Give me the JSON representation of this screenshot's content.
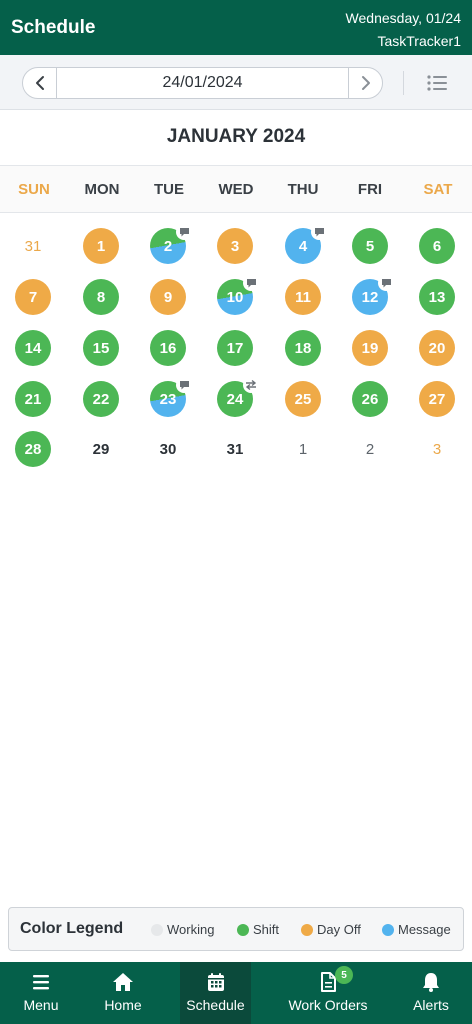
{
  "header": {
    "title": "Schedule",
    "date": "Wednesday, 01/24",
    "org": "TaskTracker1"
  },
  "navbar": {
    "current_date": "24/01/2024"
  },
  "month_title": "JANUARY 2024",
  "weekdays": [
    "SUN",
    "MON",
    "TUE",
    "WED",
    "THU",
    "FRI",
    "SAT"
  ],
  "colors": {
    "working": "#e6e8ea",
    "shift": "#4cb755",
    "dayoff": "#efaa47",
    "message": "#52b3ee",
    "header_bg": "#05604a",
    "weekend_text": "#eba84a"
  },
  "calendar": {
    "weeks": [
      [
        {
          "day": "31",
          "status": "plain",
          "style": "weekend-num"
        },
        {
          "day": "1",
          "status": "dayoff"
        },
        {
          "day": "2",
          "status": "split",
          "badge": "message-icon"
        },
        {
          "day": "3",
          "status": "dayoff"
        },
        {
          "day": "4",
          "status": "message",
          "badge": "message-icon"
        },
        {
          "day": "5",
          "status": "shift"
        },
        {
          "day": "6",
          "status": "shift"
        }
      ],
      [
        {
          "day": "7",
          "status": "dayoff"
        },
        {
          "day": "8",
          "status": "shift"
        },
        {
          "day": "9",
          "status": "dayoff"
        },
        {
          "day": "10",
          "status": "split",
          "badge": "message-icon"
        },
        {
          "day": "11",
          "status": "dayoff"
        },
        {
          "day": "12",
          "status": "message",
          "badge": "message-icon"
        },
        {
          "day": "13",
          "status": "shift"
        }
      ],
      [
        {
          "day": "14",
          "status": "shift"
        },
        {
          "day": "15",
          "status": "shift"
        },
        {
          "day": "16",
          "status": "shift"
        },
        {
          "day": "17",
          "status": "shift"
        },
        {
          "day": "18",
          "status": "shift"
        },
        {
          "day": "19",
          "status": "dayoff"
        },
        {
          "day": "20",
          "status": "dayoff"
        }
      ],
      [
        {
          "day": "21",
          "status": "shift"
        },
        {
          "day": "22",
          "status": "shift"
        },
        {
          "day": "23",
          "status": "split",
          "badge": "message-icon"
        },
        {
          "day": "24",
          "status": "shift",
          "badge": "swap-icon"
        },
        {
          "day": "25",
          "status": "dayoff"
        },
        {
          "day": "26",
          "status": "shift"
        },
        {
          "day": "27",
          "status": "dayoff"
        }
      ],
      [
        {
          "day": "28",
          "status": "shift"
        },
        {
          "day": "29",
          "status": "plain"
        },
        {
          "day": "30",
          "status": "plain"
        },
        {
          "day": "31",
          "status": "plain"
        },
        {
          "day": "1",
          "status": "plain",
          "style": "other"
        },
        {
          "day": "2",
          "status": "plain",
          "style": "other"
        },
        {
          "day": "3",
          "status": "plain",
          "style": "weekend-num"
        }
      ]
    ]
  },
  "legend": {
    "title": "Color Legend",
    "items": [
      {
        "label": "Working",
        "color": "#e6e8ea"
      },
      {
        "label": "Shift",
        "color": "#4cb755"
      },
      {
        "label": "Day Off",
        "color": "#efaa47"
      },
      {
        "label": "Message",
        "color": "#52b3ee"
      }
    ]
  },
  "tabbar": {
    "tabs": [
      {
        "label": "Menu",
        "icon": "menu-icon"
      },
      {
        "label": "Home",
        "icon": "home-icon"
      },
      {
        "label": "Schedule",
        "icon": "calendar-icon",
        "active": true
      },
      {
        "label": "Work Orders",
        "icon": "document-icon",
        "count": "5"
      },
      {
        "label": "Alerts",
        "icon": "bell-icon"
      }
    ]
  }
}
